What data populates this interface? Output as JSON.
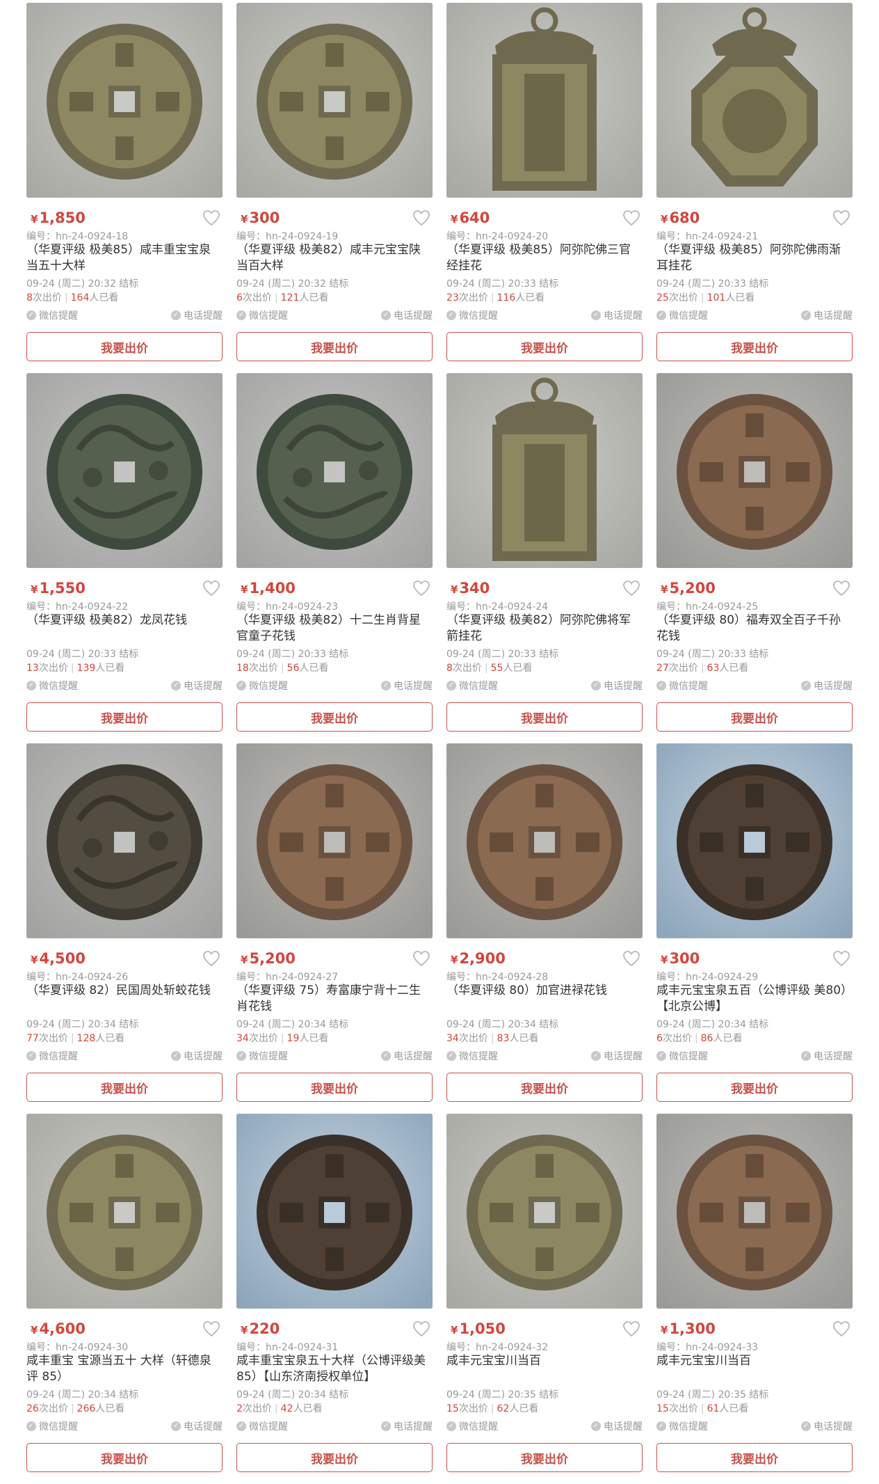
{
  "currency": "¥",
  "wechat_label": "微信提醒",
  "phone_label": "电话提醒",
  "bid_label": "我要出价",
  "bids_suffix": "次出价",
  "viewers_suffix": "人已看",
  "colors": {
    "accent": "#d4453d",
    "muted": "#999999",
    "button_border": "#c8514a"
  },
  "lots": [
    {
      "price": "1,850",
      "code": "编号：hn-24-0924-18",
      "title": "（华夏评级 极美85）咸丰重宝宝泉当五十大样",
      "end": "09-24 (周二) 20:32 结标",
      "bids": "8",
      "views": "164",
      "image": "round-coin",
      "tone": "bronze"
    },
    {
      "price": "300",
      "code": "编号：hn-24-0924-19",
      "title": "（华夏评级 极美82）咸丰元宝宝陕当百大样",
      "end": "09-24 (周二) 20:32 结标",
      "bids": "6",
      "views": "121",
      "image": "round-coin",
      "tone": "bronze"
    },
    {
      "price": "640",
      "code": "编号：hn-24-0924-20",
      "title": "（华夏评级 极美85）阿弥陀佛三官经挂花",
      "end": "09-24 (周二) 20:33 结标",
      "bids": "23",
      "views": "116",
      "image": "pendant-rect",
      "tone": "bronze"
    },
    {
      "price": "680",
      "code": "编号：hn-24-0924-21",
      "title": "（华夏评级 极美85）阿弥陀佛雨渐耳挂花",
      "end": "09-24 (周二) 20:33 结标",
      "bids": "25",
      "views": "101",
      "image": "pendant-oct",
      "tone": "bronze"
    },
    {
      "price": "1,550",
      "code": "编号：hn-24-0924-22",
      "title": "（华夏评级 极美82）龙凤花钱",
      "end": "09-24 (周二) 20:33 结标",
      "bids": "13",
      "views": "139",
      "image": "round-charm",
      "tone": "green"
    },
    {
      "price": "1,400",
      "code": "编号：hn-24-0924-23",
      "title": "（华夏评级 极美82）十二生肖背星官童子花钱",
      "end": "09-24 (周二) 20:33 结标",
      "bids": "18",
      "views": "56",
      "image": "round-charm",
      "tone": "green"
    },
    {
      "price": "340",
      "code": "编号：hn-24-0924-24",
      "title": "（华夏评级 极美82）阿弥陀佛将军箭挂花",
      "end": "09-24 (周二) 20:33 结标",
      "bids": "8",
      "views": "55",
      "image": "pendant-rect",
      "tone": "bronze"
    },
    {
      "price": "5,200",
      "code": "编号：hn-24-0924-25",
      "title": "（华夏评级 80）福寿双全百子千孙花钱",
      "end": "09-24 (周二) 20:33 结标",
      "bids": "27",
      "views": "63",
      "image": "round-coin",
      "tone": "copper"
    },
    {
      "price": "4,500",
      "code": "编号：hn-24-0924-26",
      "title": "（华夏评级 82）民国周处斩蛟花钱",
      "end": "09-24 (周二) 20:34 结标",
      "bids": "77",
      "views": "128",
      "image": "round-charm",
      "tone": "dark"
    },
    {
      "price": "5,200",
      "code": "编号：hn-24-0924-27",
      "title": "（华夏评级 75）寿富康宁背十二生肖花钱",
      "end": "09-24 (周二) 20:34 结标",
      "bids": "34",
      "views": "19",
      "image": "round-coin",
      "tone": "copper"
    },
    {
      "price": "2,900",
      "code": "编号：hn-24-0924-28",
      "title": "（华夏评级 80）加官进禄花钱",
      "end": "09-24 (周二) 20:34 结标",
      "bids": "34",
      "views": "83",
      "image": "round-coin",
      "tone": "copper"
    },
    {
      "price": "300",
      "code": "编号：hn-24-0924-29",
      "title": "咸丰元宝宝泉五百（公博评级 美80）【北京公博】",
      "end": "09-24 (周二) 20:34 结标",
      "bids": "6",
      "views": "86",
      "image": "round-coin",
      "tone": "dark-blue"
    },
    {
      "price": "4,600",
      "code": "编号：hn-24-0924-30",
      "title": "咸丰重宝 宝源当五十 大样（轩德泉评 85）",
      "end": "09-24 (周二) 20:34 结标",
      "bids": "26",
      "views": "266",
      "image": "round-coin",
      "tone": "bronze"
    },
    {
      "price": "220",
      "code": "编号：hn-24-0924-31",
      "title": "咸丰重宝宝泉五十大样（公博评级美85）【山东济南授权单位】",
      "end": "09-24 (周二) 20:34 结标",
      "bids": "2",
      "views": "42",
      "image": "round-coin",
      "tone": "dark-blue"
    },
    {
      "price": "1,050",
      "code": "编号：hn-24-0924-32",
      "title": "咸丰元宝宝川当百",
      "end": "09-24 (周二) 20:35 结标",
      "bids": "15",
      "views": "62",
      "image": "round-coin",
      "tone": "bronze"
    },
    {
      "price": "1,300",
      "code": "编号：hn-24-0924-33",
      "title": "咸丰元宝宝川当百",
      "end": "09-24 (周二) 20:35 结标",
      "bids": "15",
      "views": "61",
      "image": "round-coin",
      "tone": "copper"
    }
  ]
}
